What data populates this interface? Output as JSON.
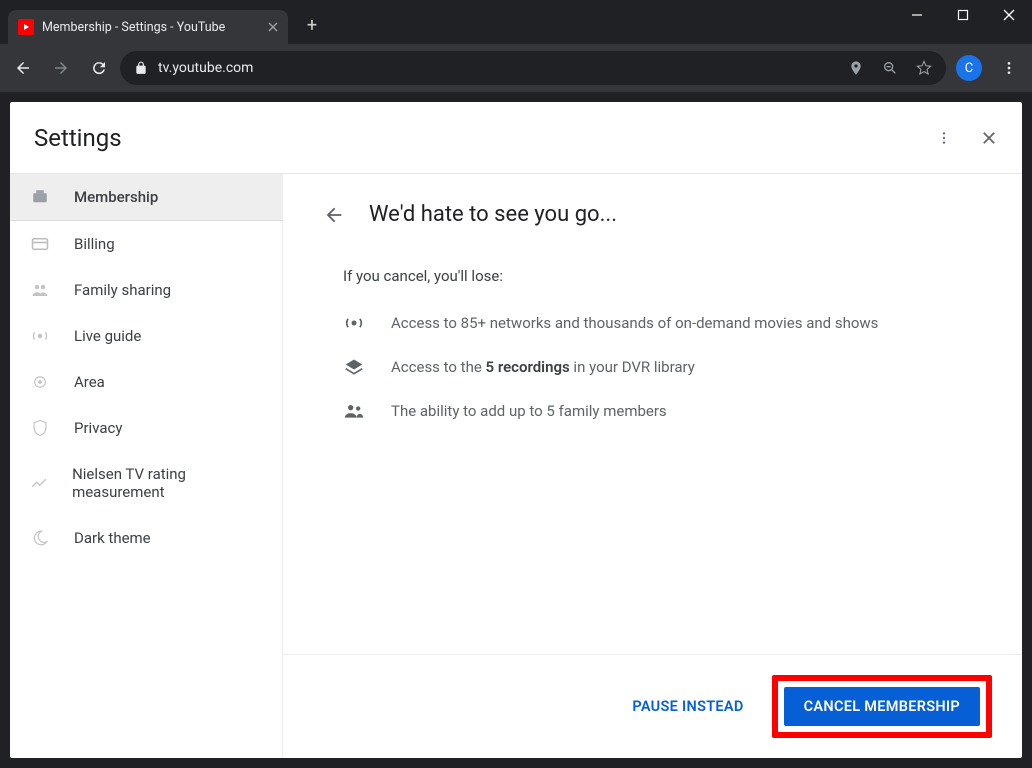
{
  "browser": {
    "tab_title": "Membership - Settings - YouTube",
    "url": "tv.youtube.com",
    "avatar_initial": "C"
  },
  "header": {
    "title": "Settings"
  },
  "sidebar": {
    "items": [
      {
        "label": "Membership"
      },
      {
        "label": "Billing"
      },
      {
        "label": "Family sharing"
      },
      {
        "label": "Live guide"
      },
      {
        "label": "Area"
      },
      {
        "label": "Privacy"
      },
      {
        "label": "Nielsen TV rating measurement"
      },
      {
        "label": "Dark theme"
      }
    ]
  },
  "main": {
    "heading": "We'd hate to see you go...",
    "sub": "If you cancel, you'll lose:",
    "loss_networks": "Access to 85+ networks and thousands of on-demand movies and shows",
    "loss_dvr_pre": "Access to the ",
    "loss_dvr_bold": "5 recordings",
    "loss_dvr_post": " in your DVR library",
    "loss_family": "The ability to add up to 5 family members",
    "pause_btn": "PAUSE INSTEAD",
    "cancel_btn": "CANCEL MEMBERSHIP"
  }
}
